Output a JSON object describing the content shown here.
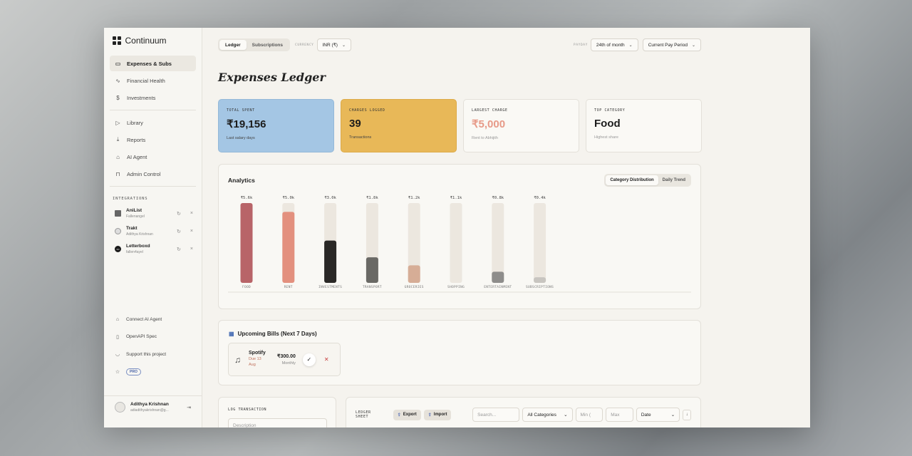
{
  "app": {
    "name": "Continuum"
  },
  "sidebar": {
    "nav": [
      {
        "label": "Expenses & Subs",
        "icon": "card-icon",
        "glyph": "▭",
        "active": true
      },
      {
        "label": "Financial Health",
        "icon": "pulse-icon",
        "glyph": "∿",
        "active": false
      },
      {
        "label": "Investments",
        "icon": "dollar-icon",
        "glyph": "$",
        "active": false
      }
    ],
    "nav2": [
      {
        "label": "Library",
        "icon": "video-icon",
        "glyph": "▷"
      },
      {
        "label": "Reports",
        "icon": "download-icon",
        "glyph": "⤓"
      },
      {
        "label": "AI Agent",
        "icon": "bot-icon",
        "glyph": "⌂"
      },
      {
        "label": "Admin Control",
        "icon": "lock-icon",
        "glyph": "⊓"
      }
    ],
    "integrations_label": "INTEGRATIONS",
    "integrations": [
      {
        "name": "AniList",
        "user": "Fallenangel",
        "logo": "anilist-logo"
      },
      {
        "name": "Trakt",
        "user": "Adithya Krishnan",
        "logo": "trakt-logo"
      },
      {
        "name": "Letterboxd",
        "user": "fallen4ayel",
        "logo": "letterboxd-logo"
      }
    ],
    "bottom": [
      {
        "label": "Connect AI Agent",
        "icon": "plug-icon",
        "glyph": "⌂"
      },
      {
        "label": "OpenAPI Spec",
        "icon": "doc-icon",
        "glyph": "▯"
      },
      {
        "label": "Support this project",
        "icon": "cup-icon",
        "glyph": "◡"
      }
    ],
    "pro_badge": "PRO",
    "user": {
      "name": "Adithya Krishnan",
      "email": "adiadithyakrishnan@g..."
    }
  },
  "topbar": {
    "tabs": [
      "Ledger",
      "Subscriptions"
    ],
    "currency_label": "CURRENCY",
    "currency": "INR (₹)",
    "payday_label": "PAYDAY",
    "payday": "24th of month",
    "period": "Current Pay Period"
  },
  "page_title": "Expenses Ledger",
  "cards": [
    {
      "label": "TOTAL SPENT",
      "value": "₹19,156",
      "sub": "Last salary days"
    },
    {
      "label": "CHARGES LOGGED",
      "value": "39",
      "sub": "Transactions"
    },
    {
      "label": "LARGEST CHARGE",
      "value": "₹5,000",
      "sub": "Rent to Abhijith"
    },
    {
      "label": "TOP CATEGORY",
      "value": "Food",
      "sub": "Highest share"
    }
  ],
  "analytics": {
    "title": "Analytics",
    "tabs": [
      "Category Distribution",
      "Daily Trend"
    ]
  },
  "chart_data": {
    "type": "bar",
    "categories": [
      "FOOD",
      "RENT",
      "INVESTMENTS",
      "TRANSPORT",
      "GROCERIES",
      "SHOPPING",
      "ENTERTAINMENT",
      "SUBSCRIPTIONS"
    ],
    "values": [
      5.6,
      5.0,
      3.0,
      1.8,
      1.2,
      1.1,
      0.8,
      0.4
    ],
    "value_labels": [
      "₹5.6k",
      "₹5.0k",
      "₹3.0k",
      "₹1.8k",
      "₹1.2k",
      "₹1.1k",
      "₹0.8k",
      "₹0.4k"
    ],
    "fill_fractions": [
      1.0,
      0.89,
      0.53,
      0.32,
      0.22,
      0.0,
      0.14,
      0.07
    ],
    "colors": [
      "#b86468",
      "#e3907e",
      "#2a2826",
      "#6a6965",
      "#d6ad96",
      "#eeeae4",
      "#8e8d8b",
      "#c8c5c0"
    ],
    "track_color": "#ece7df"
  },
  "bills": {
    "title": "Upcoming Bills (Next 7 Days)",
    "items": [
      {
        "name": "Spotify",
        "due": "Due 13 Aug",
        "amount": "₹300.00",
        "freq": "Monthly"
      }
    ]
  },
  "log": {
    "label": "LOG TRANSACTION",
    "description_placeholder": "Description"
  },
  "sheet": {
    "label": "LEDGER SHEET",
    "export": "Export",
    "import": "Import",
    "search_placeholder": "Search...",
    "category": "All Categories",
    "min_placeholder": "Min (",
    "max_placeholder": "Max",
    "sort": "Date"
  }
}
